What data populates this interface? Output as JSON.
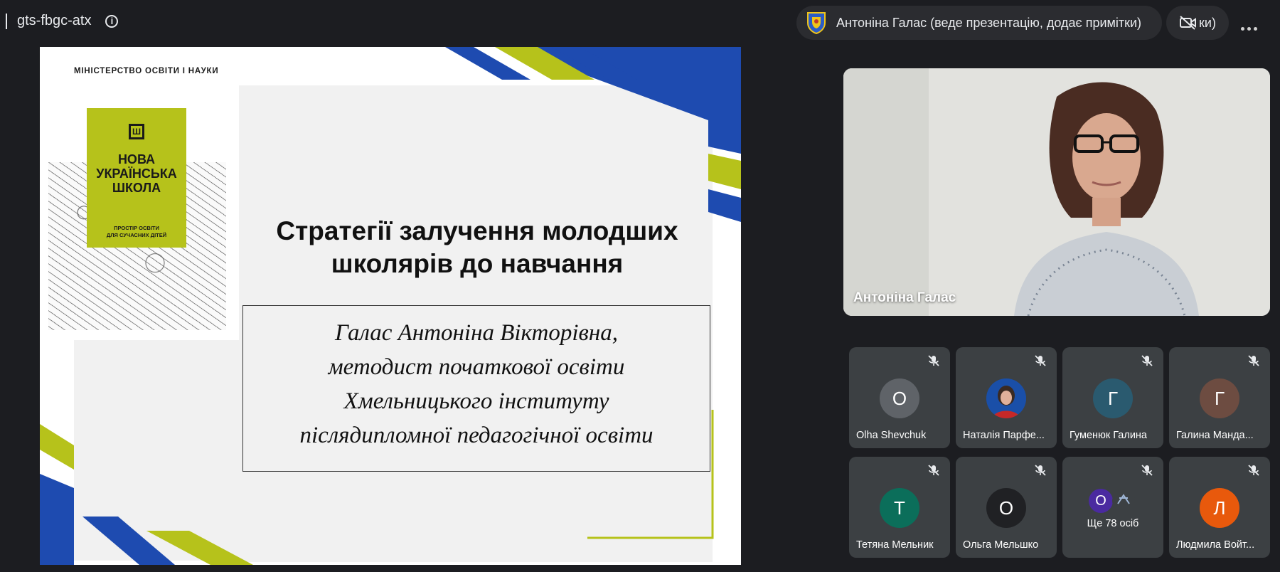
{
  "meeting": {
    "code": "gts-fbgc-atx",
    "info_icon": "info-icon"
  },
  "presenter": {
    "label": "Антоніна Галас (веде презентацію, додає примітки)",
    "icon": "crest-icon"
  },
  "camera": {
    "label": "ки)",
    "icon": "camera-off-icon"
  },
  "slide": {
    "ministry": "МІНІСТЕРСТВО ОСВІТИ І НАУКИ",
    "nus_logo": "Ш",
    "nus_title": [
      "НОВА",
      "УКРАЇНСЬКА",
      "ШКОЛА"
    ],
    "nus_subtitle": [
      "ПРОСТІР ОСВІТИ",
      "ДЛЯ СУЧАСНИХ ДІТЕЙ"
    ],
    "title_lines": [
      "Стратегії залучення молодших",
      "школярів до навчання"
    ],
    "author_lines": [
      "Галас Антоніна Вікторівна,",
      "методист початкової освіти",
      "Хмельницького інституту",
      "післядипломної педагогічної освіти"
    ],
    "colors": {
      "blue": "#1e4bb0",
      "green": "#b6c21b",
      "white": "#ffffff"
    }
  },
  "main_video": {
    "name": "Антоніна Галас"
  },
  "participants": [
    {
      "name": "Olha Shevchuk",
      "initial": "О",
      "color": "#5f6368",
      "muted": true
    },
    {
      "name": "Наталія Парфе...",
      "initial": "",
      "color": "#1a4fa8",
      "muted": true,
      "photo": true
    },
    {
      "name": "Гуменюк Галина",
      "initial": "Г",
      "color": "#2a5a6f",
      "muted": true
    },
    {
      "name": "Галина Манда...",
      "initial": "Г",
      "color": "#6d4c41",
      "muted": true
    },
    {
      "name": "Тетяна Мельник",
      "initial": "Т",
      "color": "#0b6e5a",
      "muted": true
    },
    {
      "name": "Ольга Мельшко",
      "initial": "О",
      "color": "#202124",
      "muted": true
    },
    {
      "name": "Ще 78 осіб",
      "initial": "О",
      "color": "#4a2aa0",
      "muted": true,
      "more": true
    },
    {
      "name": "Людмила Войт...",
      "initial": "Л",
      "color": "#e8590c",
      "muted": true
    }
  ]
}
